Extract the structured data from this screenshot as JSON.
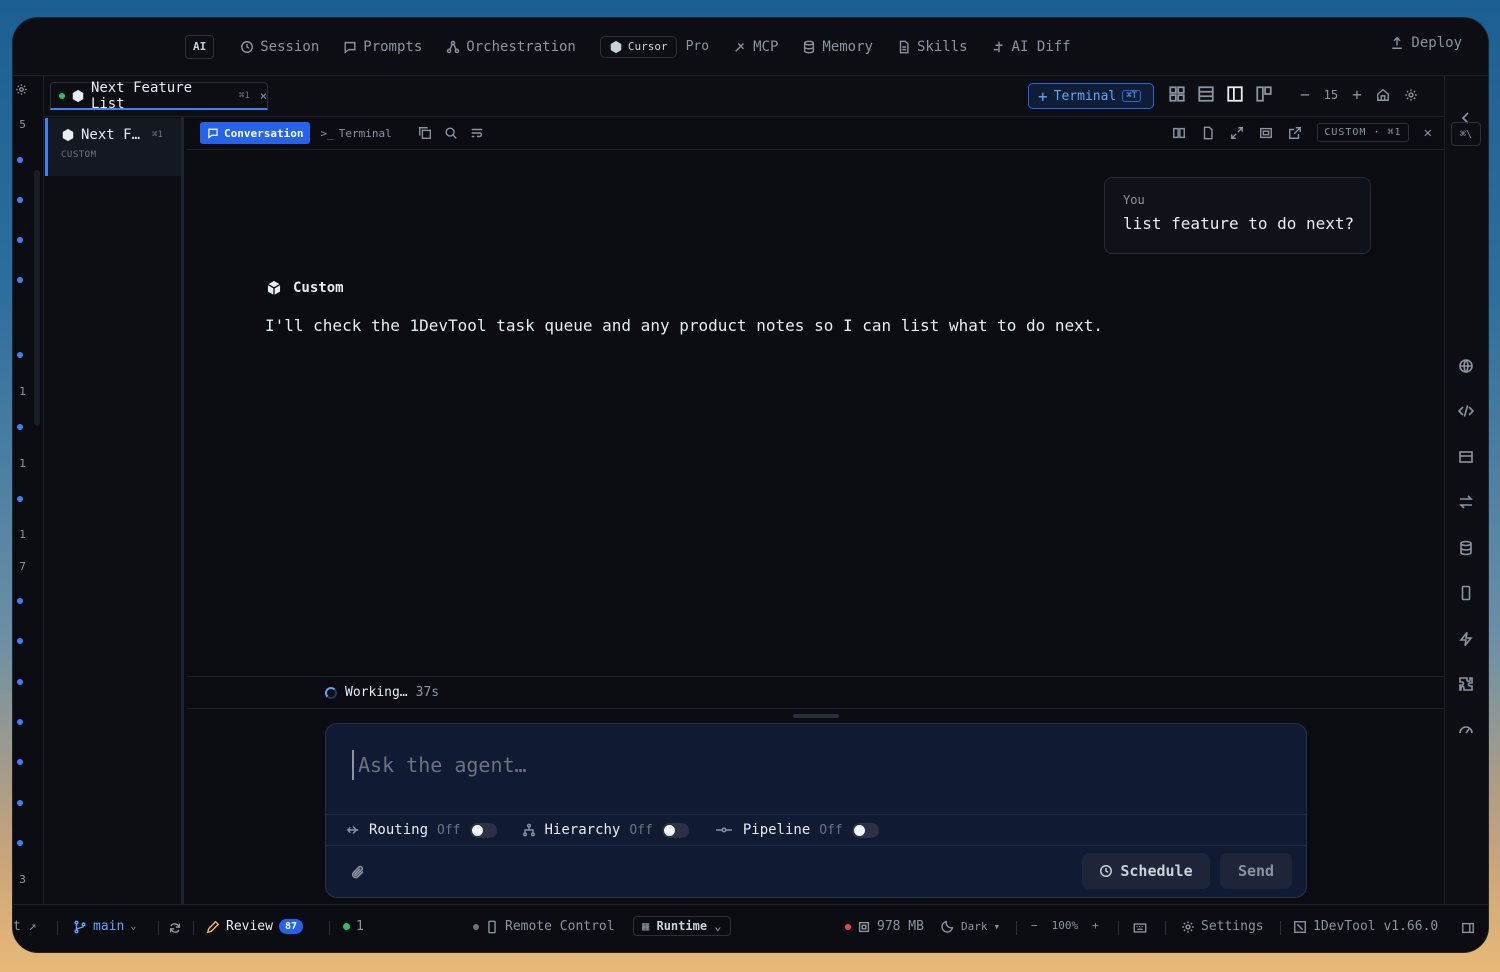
{
  "topnav": {
    "ai_badge": "AI",
    "items": [
      {
        "label": "Session",
        "icon": "clock-icon"
      },
      {
        "label": "Prompts",
        "icon": "message-icon"
      },
      {
        "label": "Orchestration",
        "icon": "nodes-icon"
      }
    ],
    "cursor_label": "Cursor",
    "pro_label": "Pro",
    "items2": [
      {
        "label": "MCP",
        "icon": "plug-icon"
      },
      {
        "label": "Memory",
        "icon": "database-icon"
      },
      {
        "label": "Skills",
        "icon": "document-icon"
      },
      {
        "label": "AI Diff",
        "icon": "diff-icon"
      }
    ],
    "deploy_label": "Deploy"
  },
  "left_rail": {
    "marks": [
      "5",
      "1",
      "1",
      "1",
      "7",
      "3"
    ],
    "bottom_label": "t ↗"
  },
  "tabbar": {
    "tab_title": "Next Feature List",
    "tab_kbd": "⌘1",
    "close": "×",
    "terminal_label": "Terminal",
    "terminal_kbd": "⌘T",
    "zoom_value": "15",
    "minus": "−",
    "plus": "+"
  },
  "session": {
    "title": "Next F…",
    "kbd": "⌘1",
    "subtitle": "CUSTOM"
  },
  "subbar": {
    "conversation_label": "Conversation",
    "terminal_label": "Terminal",
    "custom_pill": "CUSTOM · ⌘1",
    "close": "✕"
  },
  "chat": {
    "you_label": "You",
    "you_text": "list feature to do next?",
    "agent_name": "Custom",
    "agent_text": "I'll check the 1DevTool task queue and any product notes so I can list what to do next."
  },
  "working": {
    "text": "Working…",
    "time": "37s"
  },
  "composer": {
    "placeholder": "Ask the agent…",
    "options": [
      {
        "label": "Routing",
        "state": "Off",
        "icon": "routing-icon"
      },
      {
        "label": "Hierarchy",
        "state": "Off",
        "icon": "hierarchy-icon"
      },
      {
        "label": "Pipeline",
        "state": "Off",
        "icon": "pipeline-icon"
      }
    ],
    "schedule_label": "Schedule",
    "send_label": "Send"
  },
  "right_rail": {
    "kbd": "⌘\\"
  },
  "statusbar": {
    "branch": "main",
    "review_label": "Review",
    "review_count": "87",
    "agents_count": "1",
    "remote_label": "Remote Control",
    "runtime_label": "Runtime",
    "memory": "978 MB",
    "theme": "Dark",
    "zoom": "100%",
    "minus": "−",
    "plus": "+",
    "settings_label": "Settings",
    "version": "1DevTool v1.66.0"
  },
  "colors": {
    "accent": "#3b82f6",
    "background": "#0a0c12",
    "composer_bg": "#111a33",
    "success": "#22c55e",
    "danger": "#ef4444"
  }
}
